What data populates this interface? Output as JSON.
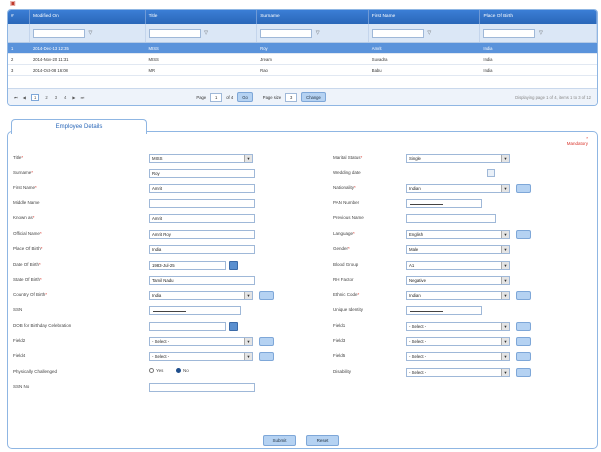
{
  "grid": {
    "columns": [
      "#",
      "Modified On",
      "Title",
      "Surname",
      "First Name",
      "Place Of Birth"
    ],
    "rows": [
      {
        "num": "1",
        "modified": "2014-Dec-13 12:35",
        "title": "MISS",
        "surname": "Roy",
        "first": "Amrit",
        "pob": "India"
      },
      {
        "num": "2",
        "modified": "2014-Nov-20 11:31",
        "title": "MISS",
        "surname": "Jream",
        "first": "Suvadra",
        "pob": "India"
      },
      {
        "num": "3",
        "modified": "2014-Oct-08 16:08",
        "title": "MR",
        "surname": "Rao",
        "first": "Babu",
        "pob": "India"
      }
    ],
    "pager": {
      "pages": [
        "1",
        "2",
        "3",
        "4"
      ],
      "page_label": "Page",
      "page_value": "1",
      "of_label": "of 4",
      "go_label": "Go",
      "size_label": "Page size",
      "size_value": "3",
      "change_label": "Change",
      "info": "Displaying page 1 of 4, items 1 to 3 of 12"
    }
  },
  "form": {
    "tab_label": "Employee Details",
    "mandatory": "Mandatory",
    "left": {
      "title_label": "Title",
      "title_value": "MISS",
      "surname_label": "Surname",
      "surname_value": "Roy",
      "first_label": "First Name",
      "first_value": "Amrit",
      "middle_label": "Middle Name",
      "known_label": "Known as",
      "known_value": "Amrit",
      "official_label": "Official Name",
      "official_value": "Amrit Roy",
      "pob_label": "Place Of Birth",
      "pob_value": "India",
      "dob_label": "Date Of Birth",
      "dob_value": "1983-Jul-25",
      "state_label": "State Of Birth",
      "state_value": "Tamil Nadu",
      "country_label": "Country Of Birth",
      "country_value": "India",
      "ssn_label": "SSN",
      "dobcel_label": "DOB for Birthday Celebration",
      "field2_label": "Field2",
      "field2_value": "- Select -",
      "field4_label": "Field4",
      "field4_value": "- Select -",
      "physical_label": "Physically Challenged",
      "yes_label": "Yes",
      "no_label": "No",
      "ssn2_label": "SSN No"
    },
    "right": {
      "marital_label": "Marital Status",
      "marital_value": "Single",
      "wedding_label": "Wedding date",
      "nationality_label": "Nationality",
      "nationality_value": "Indian",
      "pan_label": "PAN Number",
      "previous_label": "Previous Name",
      "language_label": "Language",
      "language_value": "English",
      "gender_label": "Gender",
      "gender_value": "Male",
      "blood_label": "Blood Group",
      "blood_value": "A1",
      "rh_label": "RH Factor",
      "rh_value": "Negative",
      "ethnic_label": "Ethnic Code",
      "ethnic_value": "Indian",
      "unique_label": "Unique Identity",
      "field1_label": "Field1",
      "field1_value": "- Select -",
      "field3_label": "Field3",
      "field3_value": "- Select -",
      "field5_label": "Field5",
      "field5_value": "- Select -",
      "disability_label": "Disability",
      "disability_value": "- Select -"
    },
    "submit_label": "Submit",
    "reset_label": "Reset"
  }
}
